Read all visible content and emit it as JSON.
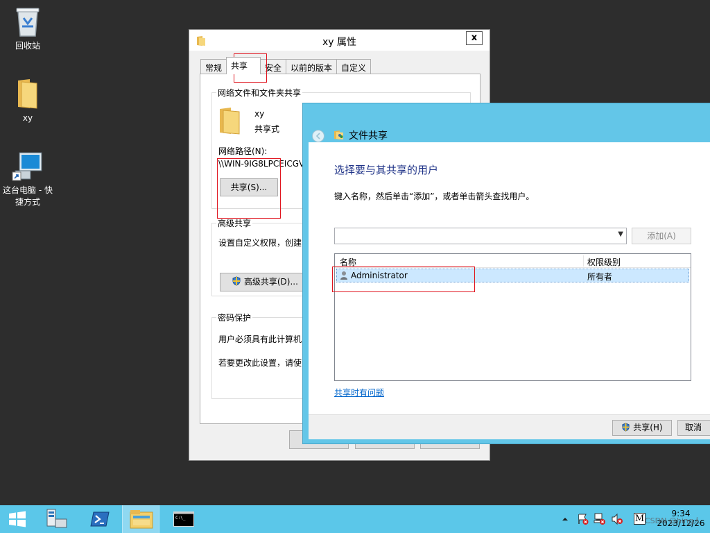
{
  "desktop": {
    "icons": [
      {
        "label": "回收站",
        "icon": "recycle-bin-icon"
      },
      {
        "label": "xy",
        "icon": "folder-icon"
      },
      {
        "label": "这台电脑 - 快\n捷方式",
        "icon": "computer-shortcut-icon"
      }
    ]
  },
  "properties_dialog": {
    "title": "xy 属性",
    "close_label": "x",
    "tabs": [
      "常规",
      "共享",
      "安全",
      "以前的版本",
      "自定义"
    ],
    "active_tab": "共享",
    "network_group": {
      "label": "网络文件和文件夹共享",
      "folder_name": "xy",
      "share_status": "共享式",
      "path_label": "网络路径(N):",
      "path_value": "\\\\WIN-9IG8LPCEICGV",
      "share_button": "共享(S)..."
    },
    "advanced_group": {
      "label": "高级共享",
      "description": "设置自定义权限，创建",
      "button": "高级共享(D)..."
    },
    "password_group": {
      "label": "密码保护",
      "line1": "用户必须具有此计算机",
      "line2": "若要更改此设置，请使"
    }
  },
  "file_sharing_wizard": {
    "title": "文件共享",
    "heading": "选择要与其共享的用户",
    "instruction": "键入名称，然后单击“添加”，或者单击箭头查找用户。",
    "input_value": "",
    "add_button": "添加(A)",
    "columns": [
      "名称",
      "权限级别"
    ],
    "rows": [
      {
        "name": "Administrator",
        "permission": "所有者"
      }
    ],
    "help_link": "共享时有问题",
    "share_button": "共享(H)",
    "cancel_button": "取消"
  },
  "taskbar": {
    "items": [
      "start-icon",
      "server-manager-icon",
      "powershell-icon",
      "file-explorer-icon",
      "cmd-icon"
    ],
    "tray_icons": [
      "show-hidden-icons-icon",
      "action-center-icon",
      "network-icon",
      "volume-muted-icon",
      "input-method-icon"
    ],
    "ime_label": "M",
    "time": "9:34",
    "date": "2023/12/26",
    "watermark": "CSDN @hing人"
  },
  "colors": {
    "desktop": "#2d2d2d",
    "taskbar": "#5bc7e9",
    "wizard_frame": "#63c6e8",
    "heading": "#1e3287",
    "link": "#0066cc",
    "selection": "#cce8ff",
    "annotation": "#e0141e"
  }
}
